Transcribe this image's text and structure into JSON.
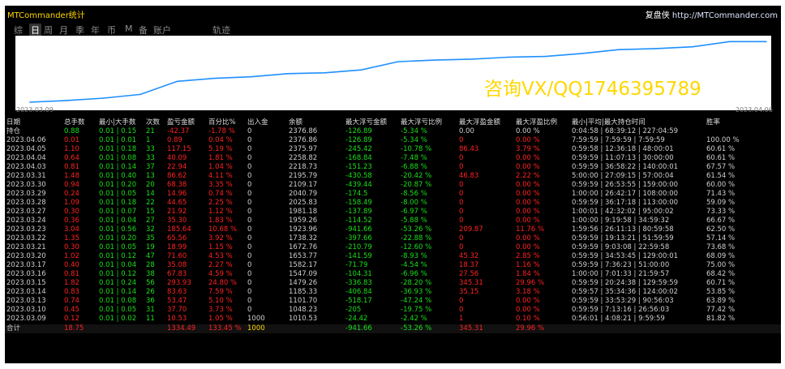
{
  "window": {
    "title": "MTCommander统计",
    "brand": "复盘侠",
    "url": "http://MTCommander.com"
  },
  "tabs": [
    "综",
    "日",
    "周",
    "月",
    "季",
    "年",
    "币",
    "M",
    "备",
    "账户",
    "轨迹"
  ],
  "active_tab": "日",
  "chart": {
    "watermark": "咨询VX/QQ1746395789",
    "date_start": "2023.03.09",
    "date_end": "2023.04.06",
    "line_color": "#1e90ff"
  },
  "chart_data": {
    "type": "line",
    "x": [
      "2023.03.09",
      "2023.03.10",
      "2023.03.13",
      "2023.03.14",
      "2023.03.15",
      "2023.03.16",
      "2023.03.17",
      "2023.03.20",
      "2023.03.21",
      "2023.03.22",
      "2023.03.23",
      "2023.03.24",
      "2023.03.27",
      "2023.03.28",
      "2023.03.29",
      "2023.03.30",
      "2023.03.31",
      "2023.04.03",
      "2023.04.04",
      "2023.04.05",
      "2023.04.06"
    ],
    "values": [
      1010.53,
      1048.23,
      1101.7,
      1185.33,
      1479.26,
      1547.09,
      1582.17,
      1653.77,
      1672.76,
      1738.32,
      1923.96,
      1959.26,
      1981.18,
      2025.83,
      2040.79,
      2109.17,
      2195.79,
      2218.73,
      2258.82,
      2375.97,
      2376.86
    ]
  },
  "table": {
    "headers": [
      "日期",
      "总手数",
      "最小|大手数",
      "次数",
      "盈亏金额",
      "百分比%",
      "出入金",
      "余额",
      "最大浮亏金额",
      "最大浮亏比例",
      "最大浮盈金额",
      "最大浮盈比例",
      "最小|平均|最大持仓时间",
      "胜率"
    ],
    "rows": [
      [
        "持仓",
        "0.88",
        "0.01 | 0.15",
        "21",
        "-42.37",
        "-1.78 %",
        "0",
        "2376.86",
        "-126.89",
        "-5.34 %",
        "0.00",
        "0.00 %",
        "0:04:58 | 68:39:12 | 227:04:59",
        ""
      ],
      [
        "2023.04.06",
        "0.01",
        "0.01 | 0.01",
        "1",
        "0.89",
        "0.04 %",
        "0",
        "2376.86",
        "-126.89",
        "-5.34 %",
        "0",
        "0.00 %",
        "7:59:59 | 7:59:59 | 7:59:59",
        "100.00 %"
      ],
      [
        "2023.04.05",
        "1.10",
        "0.01 | 0.18",
        "33",
        "117.15",
        "5.19 %",
        "0",
        "2375.97",
        "-245.42",
        "-10.78 %",
        "86.43",
        "3.79 %",
        "0:59:58 | 12:36:18 | 48:00:01",
        "60.61 %"
      ],
      [
        "2023.04.04",
        "0.64",
        "0.01 | 0.08",
        "33",
        "40.09",
        "1.81 %",
        "0",
        "2258.82",
        "-168.84",
        "-7.48 %",
        "0",
        "0.00 %",
        "0:59:59 | 11:07:13 | 30:00:00",
        "60.61 %"
      ],
      [
        "2023.04.03",
        "0.81",
        "0.01 | 0.14",
        "37",
        "22.94",
        "1.04 %",
        "0",
        "2218.73",
        "-151.23",
        "-6.88 %",
        "0",
        "0.00 %",
        "0:59:59 | 36:58:22 | 140:00:01",
        "67.57 %"
      ],
      [
        "2023.03.31",
        "1.48",
        "0.01 | 0.40",
        "13",
        "86.62",
        "4.11 %",
        "0",
        "2195.79",
        "-430.58",
        "-20.42 %",
        "46.83",
        "2.22 %",
        "5:00:00 | 27:09:15 | 57:00:04",
        "61.54 %"
      ],
      [
        "2023.03.30",
        "0.94",
        "0.01 | 0.20",
        "20",
        "68.38",
        "3.35 %",
        "0",
        "2109.17",
        "-439.44",
        "-20.87 %",
        "0",
        "0.00 %",
        "0:59:59 | 26:53:55 | 159:00:00",
        "60.00 %"
      ],
      [
        "2023.03.29",
        "0.24",
        "0.01 | 0.05",
        "14",
        "14.96",
        "0.74 %",
        "0",
        "2040.79",
        "-174.5",
        "-8.56 %",
        "0",
        "0.00 %",
        "1:00:00 | 26:42:17 | 108:00:00",
        "71.43 %"
      ],
      [
        "2023.03.28",
        "1.09",
        "0.01 | 0.18",
        "22",
        "44.65",
        "2.25 %",
        "0",
        "2025.83",
        "-158.49",
        "-8.00 %",
        "0",
        "0.00 %",
        "0:59:59 | 36:17:18 | 113:00:00",
        "59.09 %"
      ],
      [
        "2023.03.27",
        "0.30",
        "0.01 | 0.07",
        "15",
        "21.92",
        "1.12 %",
        "0",
        "1981.18",
        "-137.89",
        "-6.97 %",
        "0",
        "0.00 %",
        "1:00:01 | 42:32:02 | 95:00:02",
        "73.33 %"
      ],
      [
        "2023.03.24",
        "0.36",
        "0.01 | 0.04",
        "27",
        "35.30",
        "1.83 %",
        "0",
        "1959.26",
        "-114.52",
        "-5.88 %",
        "0",
        "0.00 %",
        "1:00:00 | 9:19:58 | 34:59:32",
        "66.67 %"
      ],
      [
        "2023.03.23",
        "3.04",
        "0.01 | 0.56",
        "32",
        "185.64",
        "10.68 %",
        "0",
        "1923.96",
        "-941.66",
        "-53.26 %",
        "209.87",
        "11.76 %",
        "1:59:56 | 26:11:13 | 80:59:58",
        "62.50 %"
      ],
      [
        "2023.03.22",
        "1.35",
        "0.01 | 0.20",
        "35",
        "65.56",
        "3.92 %",
        "0",
        "1738.32",
        "-397.66",
        "-22.88 %",
        "0",
        "0.00 %",
        "0:59:59 | 19:13:21 | 51:59:59",
        "57.14 %"
      ],
      [
        "2023.03.21",
        "0.30",
        "0.01 | 0.05",
        "19",
        "18.99",
        "1.15 %",
        "0",
        "1672.76",
        "-210.79",
        "-12.60 %",
        "0",
        "0.00 %",
        "0:59:59 | 9:03:08 | 22:59:58",
        "73.68 %"
      ],
      [
        "2023.03.20",
        "1.02",
        "0.01 | 0.12",
        "47",
        "71.60",
        "4.53 %",
        "0",
        "1653.77",
        "-141.59",
        "-8.93 %",
        "45.32",
        "2.85 %",
        "0:59:59 | 34:53:45 | 129:00:01",
        "68.09 %"
      ],
      [
        "2023.03.17",
        "0.40",
        "0.01 | 0.04",
        "28",
        "35.08",
        "2.27 %",
        "0",
        "1582.17",
        "-71.79",
        "-4.54 %",
        "18.37",
        "1.16 %",
        "0:59:59 | 7:36:23 | 51:00:00",
        "75.00 %"
      ],
      [
        "2023.03.16",
        "0.81",
        "0.01 | 0.12",
        "38",
        "67.83",
        "4.59 %",
        "0",
        "1547.09",
        "-104.31",
        "-6.96 %",
        "27.56",
        "1.84 %",
        "1:00:00 | 7:01:33 | 21:59:57",
        "68.42 %"
      ],
      [
        "2023.03.15",
        "1.82",
        "0.01 | 0.24",
        "56",
        "293.93",
        "24.80 %",
        "0",
        "1479.26",
        "-336.83",
        "-28.20 %",
        "345.31",
        "29.96 %",
        "0:59:59 | 20:24:38 | 129:59:59",
        "60.71 %"
      ],
      [
        "2023.03.14",
        "0.83",
        "0.01 | 0.14",
        "26",
        "83.63",
        "7.59 %",
        "0",
        "1185.33",
        "-406.84",
        "-36.93 %",
        "35.15",
        "3.18 %",
        "0:59:57 | 35:34:36 | 124:00:02",
        "53.85 %"
      ],
      [
        "2023.03.13",
        "0.74",
        "0.01 | 0.08",
        "36",
        "53.47",
        "5.10 %",
        "0",
        "1101.70",
        "-518.17",
        "-47.24 %",
        "0",
        "0.00 %",
        "0:59:59 | 33:53:29 | 90:56:03",
        "63.89 %"
      ],
      [
        "2023.03.10",
        "0.45",
        "0.01 | 0.05",
        "31",
        "37.70",
        "3.73 %",
        "0",
        "1048.23",
        "-205",
        "-19.75 %",
        "0",
        "0.00 %",
        "0:59:59 | 7:13:16 | 26:56:03",
        "77.42 %"
      ],
      [
        "2023.03.09",
        "0.12",
        "0.01 | 0.02",
        "11",
        "10.53",
        "1.05 %",
        "1000",
        "1010.53",
        "-24.42",
        "-2.42 %",
        "1",
        "0.10 %",
        "0:56:01 | 4:08:21 | 9:59:59",
        "81.82 %"
      ]
    ],
    "total": [
      "合计",
      "18.75",
      "",
      "",
      "1334.49",
      "133.45 %",
      "1000",
      "",
      "-941.66",
      "-53.26 %",
      "345.31",
      "29.96 %",
      "",
      ""
    ]
  }
}
